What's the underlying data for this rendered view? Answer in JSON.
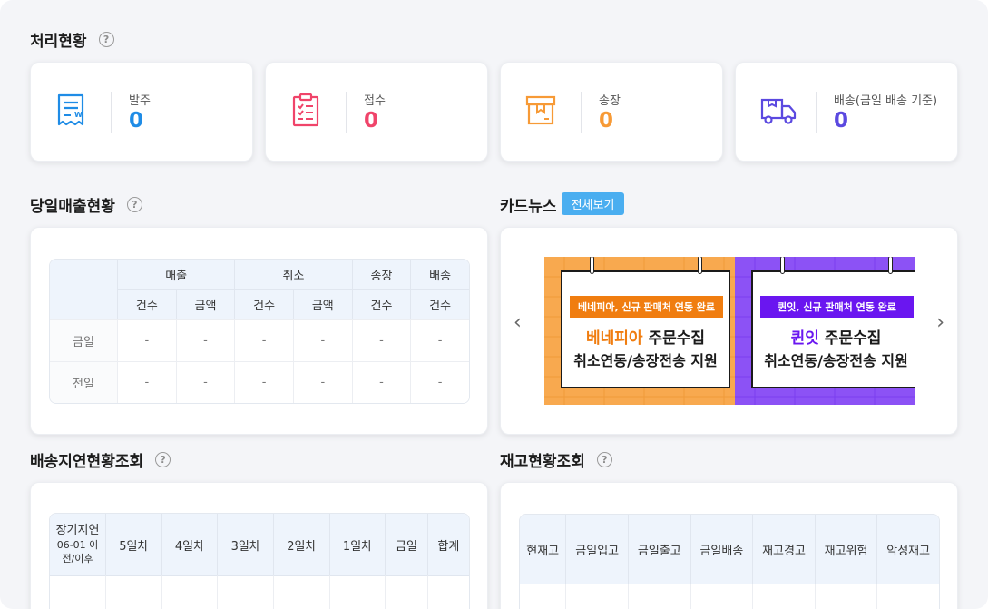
{
  "colors": {
    "order_blue": "#1f8ce6",
    "receive_red": "#f0446a",
    "invoice_orange": "#f79a36",
    "ship_purple": "#5b49e0",
    "accent_button": "#4aaef0",
    "table_header_bg": "#eef4fc"
  },
  "status": {
    "title": "처리현황",
    "help": "?",
    "cards": [
      {
        "icon": "receipt-icon",
        "label": "발주",
        "value": "0"
      },
      {
        "icon": "clipboard-checklist-icon",
        "label": "접수",
        "value": "0"
      },
      {
        "icon": "box-icon",
        "label": "송장",
        "value": "0"
      },
      {
        "icon": "delivery-truck-icon",
        "label": "배송(금일 배송 기준)",
        "value": "0"
      }
    ]
  },
  "sales": {
    "title": "당일매출현황",
    "help": "?",
    "groups": [
      "매출",
      "취소",
      "송장",
      "배송"
    ],
    "subheaders": [
      "건수",
      "금액",
      "건수",
      "금액",
      "건수",
      "건수"
    ],
    "rows": [
      {
        "label": "금일",
        "cells": [
          "-",
          "-",
          "-",
          "-",
          "-",
          "-"
        ]
      },
      {
        "label": "전일",
        "cells": [
          "-",
          "-",
          "-",
          "-",
          "-",
          "-"
        ]
      }
    ]
  },
  "cardnews": {
    "title": "카드뉴스",
    "view_all": "전체보기",
    "prev_icon": "chevron-left-icon",
    "next_icon": "chevron-right-icon",
    "prev": "‹",
    "next": "›",
    "banners": [
      {
        "tag": "베네피아, 신규 판매처 연동 완료",
        "brand": "베네피아",
        "headline_suffix": " 주문수집",
        "subline": "취소연동/송장전송 지원",
        "bg": "#f8a94f",
        "accent": "#f07d10"
      },
      {
        "tag": "퀸잇, 신규 판매처 연동 완료",
        "brand": "퀸잇",
        "headline_suffix": " 주문수집",
        "subline": "취소연동/송장전송 지원",
        "bg": "#8c52f5",
        "accent": "#6a16f0"
      }
    ]
  },
  "delay": {
    "title": "배송지연현황조회",
    "help": "?",
    "first_header": {
      "line1": "장기지연",
      "line2": "06-01 이",
      "line3": "전/이후"
    },
    "headers": [
      "5일차",
      "4일차",
      "3일차",
      "2일차",
      "1일차",
      "금일",
      "합계"
    ]
  },
  "inventory": {
    "title": "재고현황조회",
    "help": "?",
    "headers": [
      "현재고",
      "금일입고",
      "금일출고",
      "금일배송",
      "재고경고",
      "재고위험",
      "악성재고"
    ]
  }
}
